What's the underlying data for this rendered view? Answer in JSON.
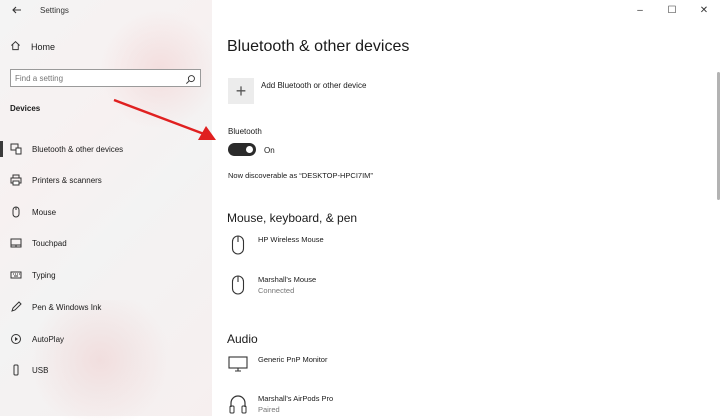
{
  "window": {
    "title": "Settings",
    "controls": {
      "minimize": "–",
      "maximize": "☐",
      "close": "✕"
    }
  },
  "sidebar": {
    "home": "Home",
    "search_placeholder": "Find a setting",
    "section": "Devices",
    "items": [
      {
        "label": "Bluetooth & other devices",
        "icon": "bluetooth-devices-icon",
        "selected": true
      },
      {
        "label": "Printers & scanners",
        "icon": "printer-icon"
      },
      {
        "label": "Mouse",
        "icon": "mouse-icon"
      },
      {
        "label": "Touchpad",
        "icon": "touchpad-icon"
      },
      {
        "label": "Typing",
        "icon": "keyboard-icon"
      },
      {
        "label": "Pen & Windows Ink",
        "icon": "pen-icon"
      },
      {
        "label": "AutoPlay",
        "icon": "autoplay-icon"
      },
      {
        "label": "USB",
        "icon": "usb-icon"
      }
    ]
  },
  "main": {
    "title": "Bluetooth & other devices",
    "add_device": "Add Bluetooth or other device",
    "bluetooth": {
      "label": "Bluetooth",
      "state": "On",
      "discoverable": "Now discoverable as “DESKTOP-HPCI7IM”"
    },
    "sections": [
      {
        "title": "Mouse, keyboard, & pen",
        "devices": [
          {
            "name": "HP Wireless Mouse",
            "status": "",
            "icon": "mouse-icon"
          },
          {
            "name": "Marshall's Mouse",
            "status": "Connected",
            "icon": "mouse-icon"
          }
        ]
      },
      {
        "title": "Audio",
        "devices": [
          {
            "name": "Generic PnP Monitor",
            "status": "",
            "icon": "monitor-icon"
          },
          {
            "name": "Marshall's AirPods Pro",
            "status": "Paired",
            "icon": "headphones-icon"
          }
        ]
      }
    ]
  },
  "colors": {
    "accent": "#e02020",
    "toggle_on": "#2b2b2b"
  }
}
